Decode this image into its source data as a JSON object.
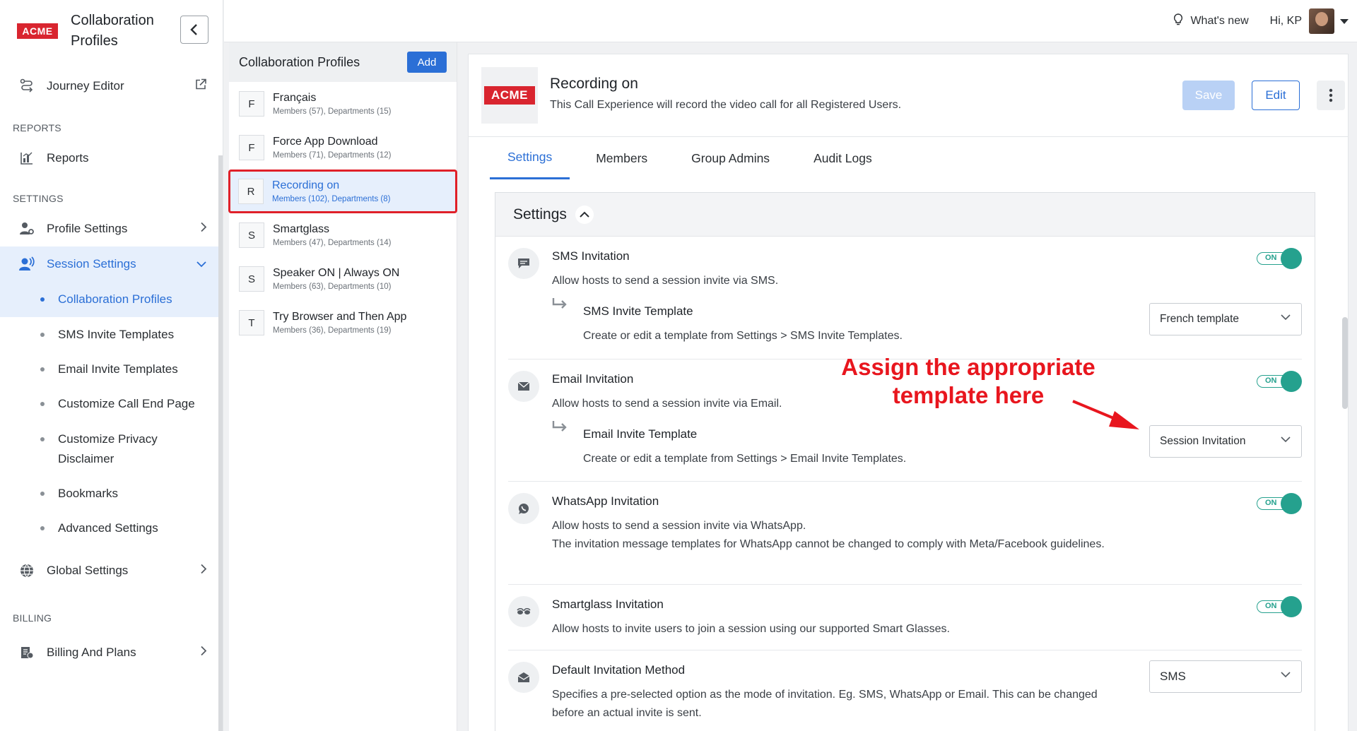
{
  "sidebar": {
    "logo": "ACME",
    "title": "Collaboration Profiles",
    "journey_editor": "Journey Editor",
    "sections": {
      "reports": "REPORTS",
      "settings": "SETTINGS",
      "billing": "BILLING"
    },
    "reports": "Reports",
    "profile_settings": "Profile Settings",
    "session_settings": "Session Settings",
    "sub_items": [
      "Collaboration Profiles",
      "SMS Invite Templates",
      "Email Invite Templates",
      "Customize Call End Page",
      "Customize Privacy Disclaimer",
      "Bookmarks",
      "Advanced Settings"
    ],
    "global_settings": "Global Settings",
    "billing_plans": "Billing And Plans"
  },
  "topbar": {
    "whats_new": "What's new",
    "greeting": "Hi, KP"
  },
  "profiles": {
    "heading": "Collaboration Profiles",
    "add_label": "Add",
    "items": [
      {
        "letter": "F",
        "name": "Français",
        "meta": "Members (57), Departments (15)"
      },
      {
        "letter": "F",
        "name": "Force App Download",
        "meta": "Members (71), Departments (12)"
      },
      {
        "letter": "R",
        "name": "Recording on",
        "meta": "Members (102), Departments (8)"
      },
      {
        "letter": "S",
        "name": "Smartglass",
        "meta": "Members (47), Departments (14)"
      },
      {
        "letter": "S",
        "name": "Speaker ON | Always ON",
        "meta": "Members (63), Departments (10)"
      },
      {
        "letter": "T",
        "name": "Try Browser and Then App",
        "meta": "Members (36), Departments (19)"
      }
    ]
  },
  "main": {
    "logo": "ACME",
    "title": "Recording on",
    "description": "This Call Experience will record the video call for all Registered Users.",
    "save_label": "Save",
    "edit_label": "Edit",
    "tabs": [
      "Settings",
      "Members",
      "Group Admins",
      "Audit Logs"
    ],
    "card_title": "Settings",
    "toggle_label": "ON",
    "rows": {
      "sms": {
        "title": "SMS Invitation",
        "desc": "Allow hosts to send a session invite via SMS.",
        "sub_title": "SMS Invite Template",
        "sub_desc": "Create or edit a template from Settings > SMS Invite Templates.",
        "select": "French template"
      },
      "email": {
        "title": "Email Invitation",
        "desc": "Allow hosts to send a session invite via Email.",
        "sub_title": "Email Invite Template",
        "sub_desc": "Create or edit a template from Settings > Email Invite Templates.",
        "select": "Session Invitation"
      },
      "whatsapp": {
        "title": "WhatsApp Invitation",
        "desc": "Allow hosts to send a session invite via WhatsApp.",
        "desc2": "The invitation message templates for WhatsApp cannot be changed to comply with Meta/Facebook guidelines."
      },
      "smartglass": {
        "title": "Smartglass Invitation",
        "desc": "Allow hosts to invite users to join a session using our supported Smart Glasses."
      },
      "default": {
        "title": "Default Invitation Method",
        "desc": "Specifies a pre-selected option as the mode of invitation. Eg. SMS, WhatsApp or Email. This can be changed before an actual invite is sent.",
        "select": "SMS"
      }
    }
  },
  "annotation": {
    "line1": "Assign the appropriate",
    "line2": "template here",
    "color": "#e8161e"
  }
}
